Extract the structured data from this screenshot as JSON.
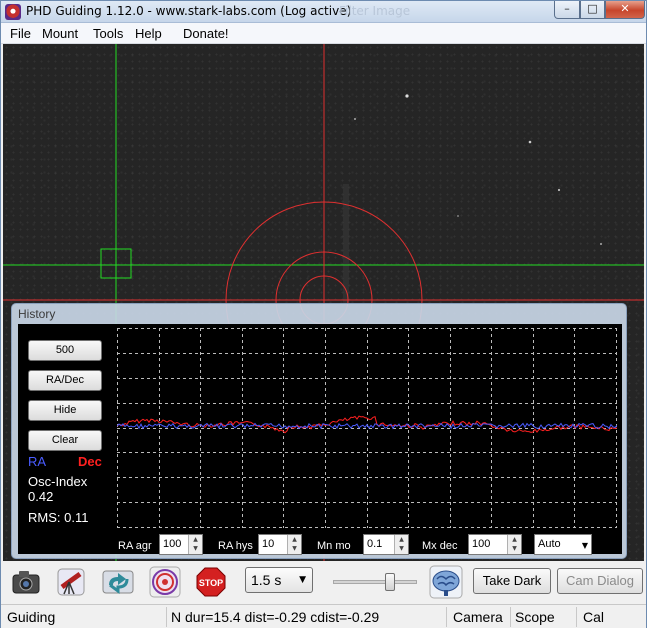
{
  "window": {
    "title": "PHD Guiding 1.12.0  -  www.stark-labs.com (Log active)",
    "ghost_title": "Filter Image"
  },
  "titlebar_buttons": {
    "minimize": "–",
    "maximize": "□",
    "close": "✕"
  },
  "menu": [
    "File",
    "Mount",
    "Tools",
    "Help",
    "Donate!"
  ],
  "history": {
    "title": "History",
    "buttons": [
      "500",
      "RA/Dec",
      "Hide",
      "Clear"
    ],
    "legend_ra": "RA",
    "legend_dec": "Dec",
    "osc_label": "Osc-Index",
    "osc_value": "0.42",
    "rms_text": "RMS: 0.11",
    "params": [
      {
        "label": "RA agr",
        "value": "100"
      },
      {
        "label": "RA hys",
        "value": "10"
      },
      {
        "label": "Mn mo",
        "value": "0.1"
      },
      {
        "label": "Mx dec",
        "value": "100"
      }
    ],
    "mode_select": "Auto"
  },
  "toolbar": {
    "exposure": "1.5 s",
    "take_dark": "Take Dark",
    "cam_dialog": "Cam Dialog"
  },
  "status": {
    "mode": "Guiding",
    "info": "N dur=15.4 dist=-0.29 cdist=-0.29",
    "camera": "Camera",
    "scope": "Scope",
    "cal": "Cal"
  },
  "colors": {
    "ra_line": "#4a5cff",
    "dec_line": "#ff2020",
    "crosshair_green": "#22dd22",
    "lock_red": "#e03030"
  }
}
